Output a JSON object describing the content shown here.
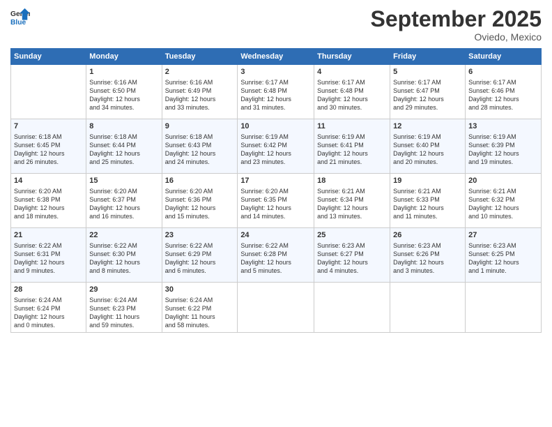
{
  "logo": {
    "line1": "General",
    "line2": "Blue"
  },
  "title": "September 2025",
  "subtitle": "Oviedo, Mexico",
  "days_of_week": [
    "Sunday",
    "Monday",
    "Tuesday",
    "Wednesday",
    "Thursday",
    "Friday",
    "Saturday"
  ],
  "weeks": [
    [
      {
        "num": "",
        "info": ""
      },
      {
        "num": "1",
        "info": "Sunrise: 6:16 AM\nSunset: 6:50 PM\nDaylight: 12 hours\nand 34 minutes."
      },
      {
        "num": "2",
        "info": "Sunrise: 6:16 AM\nSunset: 6:49 PM\nDaylight: 12 hours\nand 33 minutes."
      },
      {
        "num": "3",
        "info": "Sunrise: 6:17 AM\nSunset: 6:48 PM\nDaylight: 12 hours\nand 31 minutes."
      },
      {
        "num": "4",
        "info": "Sunrise: 6:17 AM\nSunset: 6:48 PM\nDaylight: 12 hours\nand 30 minutes."
      },
      {
        "num": "5",
        "info": "Sunrise: 6:17 AM\nSunset: 6:47 PM\nDaylight: 12 hours\nand 29 minutes."
      },
      {
        "num": "6",
        "info": "Sunrise: 6:17 AM\nSunset: 6:46 PM\nDaylight: 12 hours\nand 28 minutes."
      }
    ],
    [
      {
        "num": "7",
        "info": "Sunrise: 6:18 AM\nSunset: 6:45 PM\nDaylight: 12 hours\nand 26 minutes."
      },
      {
        "num": "8",
        "info": "Sunrise: 6:18 AM\nSunset: 6:44 PM\nDaylight: 12 hours\nand 25 minutes."
      },
      {
        "num": "9",
        "info": "Sunrise: 6:18 AM\nSunset: 6:43 PM\nDaylight: 12 hours\nand 24 minutes."
      },
      {
        "num": "10",
        "info": "Sunrise: 6:19 AM\nSunset: 6:42 PM\nDaylight: 12 hours\nand 23 minutes."
      },
      {
        "num": "11",
        "info": "Sunrise: 6:19 AM\nSunset: 6:41 PM\nDaylight: 12 hours\nand 21 minutes."
      },
      {
        "num": "12",
        "info": "Sunrise: 6:19 AM\nSunset: 6:40 PM\nDaylight: 12 hours\nand 20 minutes."
      },
      {
        "num": "13",
        "info": "Sunrise: 6:19 AM\nSunset: 6:39 PM\nDaylight: 12 hours\nand 19 minutes."
      }
    ],
    [
      {
        "num": "14",
        "info": "Sunrise: 6:20 AM\nSunset: 6:38 PM\nDaylight: 12 hours\nand 18 minutes."
      },
      {
        "num": "15",
        "info": "Sunrise: 6:20 AM\nSunset: 6:37 PM\nDaylight: 12 hours\nand 16 minutes."
      },
      {
        "num": "16",
        "info": "Sunrise: 6:20 AM\nSunset: 6:36 PM\nDaylight: 12 hours\nand 15 minutes."
      },
      {
        "num": "17",
        "info": "Sunrise: 6:20 AM\nSunset: 6:35 PM\nDaylight: 12 hours\nand 14 minutes."
      },
      {
        "num": "18",
        "info": "Sunrise: 6:21 AM\nSunset: 6:34 PM\nDaylight: 12 hours\nand 13 minutes."
      },
      {
        "num": "19",
        "info": "Sunrise: 6:21 AM\nSunset: 6:33 PM\nDaylight: 12 hours\nand 11 minutes."
      },
      {
        "num": "20",
        "info": "Sunrise: 6:21 AM\nSunset: 6:32 PM\nDaylight: 12 hours\nand 10 minutes."
      }
    ],
    [
      {
        "num": "21",
        "info": "Sunrise: 6:22 AM\nSunset: 6:31 PM\nDaylight: 12 hours\nand 9 minutes."
      },
      {
        "num": "22",
        "info": "Sunrise: 6:22 AM\nSunset: 6:30 PM\nDaylight: 12 hours\nand 8 minutes."
      },
      {
        "num": "23",
        "info": "Sunrise: 6:22 AM\nSunset: 6:29 PM\nDaylight: 12 hours\nand 6 minutes."
      },
      {
        "num": "24",
        "info": "Sunrise: 6:22 AM\nSunset: 6:28 PM\nDaylight: 12 hours\nand 5 minutes."
      },
      {
        "num": "25",
        "info": "Sunrise: 6:23 AM\nSunset: 6:27 PM\nDaylight: 12 hours\nand 4 minutes."
      },
      {
        "num": "26",
        "info": "Sunrise: 6:23 AM\nSunset: 6:26 PM\nDaylight: 12 hours\nand 3 minutes."
      },
      {
        "num": "27",
        "info": "Sunrise: 6:23 AM\nSunset: 6:25 PM\nDaylight: 12 hours\nand 1 minute."
      }
    ],
    [
      {
        "num": "28",
        "info": "Sunrise: 6:24 AM\nSunset: 6:24 PM\nDaylight: 12 hours\nand 0 minutes."
      },
      {
        "num": "29",
        "info": "Sunrise: 6:24 AM\nSunset: 6:23 PM\nDaylight: 11 hours\nand 59 minutes."
      },
      {
        "num": "30",
        "info": "Sunrise: 6:24 AM\nSunset: 6:22 PM\nDaylight: 11 hours\nand 58 minutes."
      },
      {
        "num": "",
        "info": ""
      },
      {
        "num": "",
        "info": ""
      },
      {
        "num": "",
        "info": ""
      },
      {
        "num": "",
        "info": ""
      }
    ]
  ]
}
